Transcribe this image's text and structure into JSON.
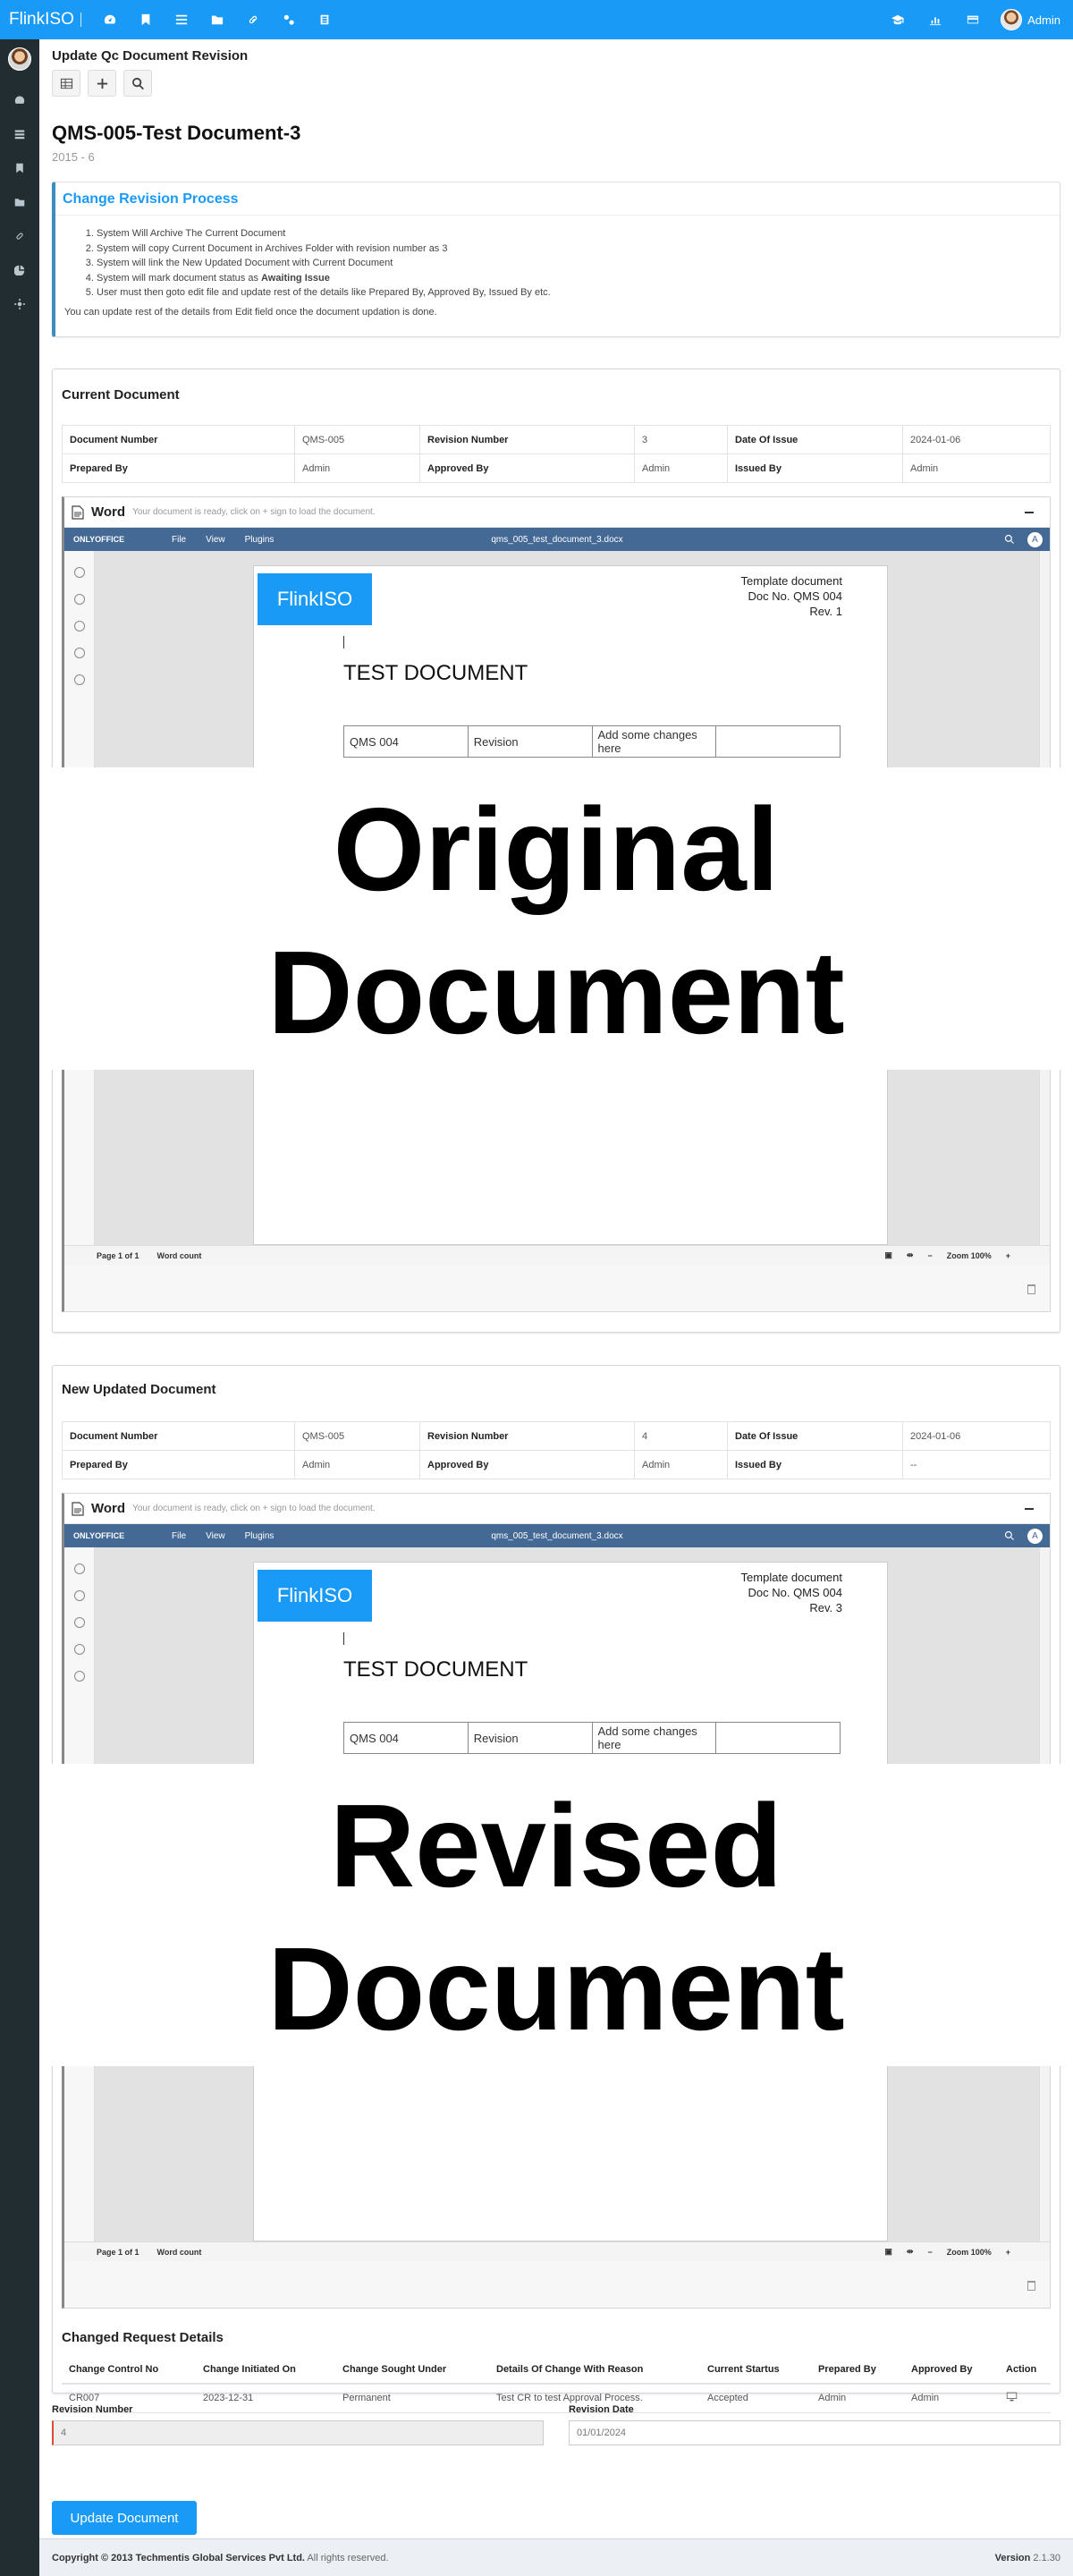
{
  "app": {
    "brand": "FlinkISO",
    "user": "Admin"
  },
  "page": {
    "heading": "Update Qc Document Revision",
    "doc_title": "QMS-005-Test Document-3",
    "doc_sub": "2015 - 6"
  },
  "process": {
    "title": "Change Revision Process",
    "steps": [
      "System Will Archive The Current Document",
      "System will copy Current Document in Archives Folder with revision number as 3",
      "System will link the New Updated Document with Current Document",
      "System will mark document status as ",
      "User must then goto edit file and update rest of the details like Prepared By, Approved By, Issued By etc."
    ],
    "step4_bold": "Awaiting Issue",
    "note": "You can update rest of the details from Edit field once the document updation is done."
  },
  "current": {
    "title": "Current Document",
    "labels": {
      "doc_number": "Document Number",
      "revision": "Revision Number",
      "date_issue": "Date Of Issue",
      "prepared": "Prepared By",
      "approved": "Approved By",
      "issued": "Issued By"
    },
    "values": {
      "doc_number": "QMS-005",
      "revision": "3",
      "date_issue": "2024-01-06",
      "prepared": "Admin",
      "approved": "Admin",
      "issued": "Admin"
    },
    "viewer": {
      "app_name": "Word",
      "note": "Your document is ready, click on + sign to load the document.",
      "oo_brand": "ONLYOFFICE",
      "menu": [
        "File",
        "View",
        "Plugins"
      ],
      "filename": "qms_005_test_document_3.docx",
      "avatar": "A",
      "logo_text": "FlinkISO",
      "template_lines": [
        "Template document",
        "Doc No. QMS 004",
        "Rev. 1"
      ],
      "heading": "TEST DOCUMENT",
      "table": [
        "QMS 004",
        "Revision",
        "Add some changes here",
        ""
      ],
      "page_label": "Page 1 of 1",
      "word_count": "Word count",
      "zoom": "Zoom 100%"
    }
  },
  "overlay_original": [
    "Original",
    "Document"
  ],
  "updated": {
    "title": "New Updated Document",
    "values": {
      "doc_number": "QMS-005",
      "revision": "4",
      "date_issue": "2024-01-06",
      "prepared": "Admin",
      "approved": "Admin",
      "issued": "--"
    },
    "viewer": {
      "template_lines": [
        "Template document",
        "Doc No. QMS 004",
        "Rev. 3"
      ]
    }
  },
  "overlay_revised": [
    "Revised",
    "Document"
  ],
  "change_request": {
    "title": "Changed Request Details",
    "headers": [
      "Change Control No",
      "Change Initiated On",
      "Change Sought Under",
      "Details Of Change With Reason",
      "Current Startus",
      "Prepared By",
      "Approved By",
      "Action"
    ],
    "row": [
      "CR007",
      "2023-12-31",
      "Permanent",
      "Test CR to test Approval Process.",
      "Accepted",
      "Admin",
      "Admin"
    ]
  },
  "form": {
    "revision_label": "Revision Number",
    "revision_value": "4",
    "date_label": "Revision Date",
    "date_value": "01/01/2024",
    "submit": "Update Document"
  },
  "footer": {
    "copyright": "Copyright © 2013 Techmentis Global Services Pvt Ltd.",
    "rights": " All rights reserved.",
    "version_label": "Version",
    "version": " 2.1.30"
  },
  "colors": {
    "primary": "#1a9af7",
    "sidebar": "#222d32",
    "onlyoffice": "#446995"
  }
}
